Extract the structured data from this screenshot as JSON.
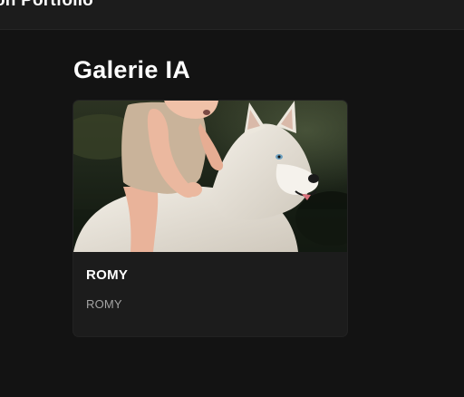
{
  "header": {
    "brand": "on Portfolio"
  },
  "main": {
    "title": "Galerie IA",
    "cards": [
      {
        "title": "ROMY",
        "subtitle": "ROMY",
        "image_description": "baby riding a white husky in a forest stream"
      }
    ]
  },
  "colors": {
    "background": "#131313",
    "header_background": "#1c1c1c",
    "card_background": "#1c1c1c",
    "title_text": "#ffffff",
    "muted_text": "#a3a3a3"
  }
}
